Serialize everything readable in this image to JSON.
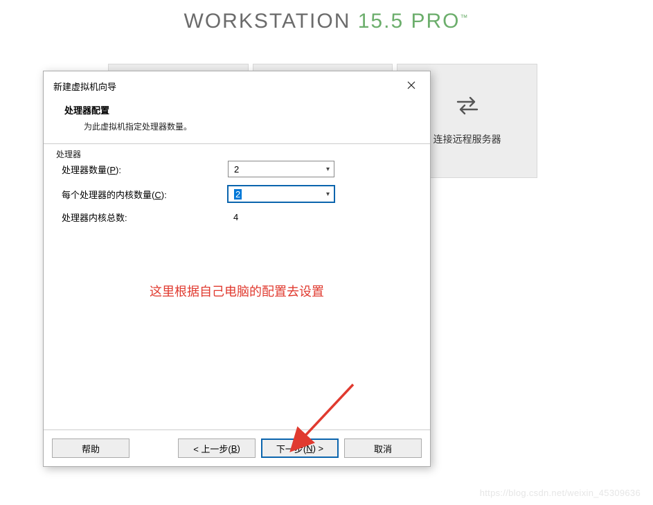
{
  "app": {
    "title_main": "WORKSTATION ",
    "title_ver": "15.5 ",
    "title_pro": "PRO",
    "title_tm": "™"
  },
  "tabs": {
    "connect_remote": "连接远程服务器"
  },
  "dialog": {
    "window_title": "新建虚拟机向导",
    "heading": "处理器配置",
    "subheading": "为此虚拟机指定处理器数量。",
    "section_legend": "处理器",
    "rows": {
      "proc_count_label_pre": "处理器数量(",
      "proc_count_label_key": "P",
      "proc_count_label_post": "):",
      "proc_count_value": "2",
      "cores_label_pre": "每个处理器的内核数量(",
      "cores_label_key": "C",
      "cores_label_post": "):",
      "cores_value": "2",
      "total_label": "处理器内核总数:",
      "total_value": "4"
    },
    "annotation": "这里根据自己电脑的配置去设置",
    "buttons": {
      "help": "帮助",
      "back_pre": "< 上一步(",
      "back_key": "B",
      "back_post": ")",
      "next_pre": "下一步(",
      "next_key": "N",
      "next_post": ") >",
      "cancel": "取消"
    }
  },
  "watermark": "https://blog.csdn.net/weixin_45309636"
}
